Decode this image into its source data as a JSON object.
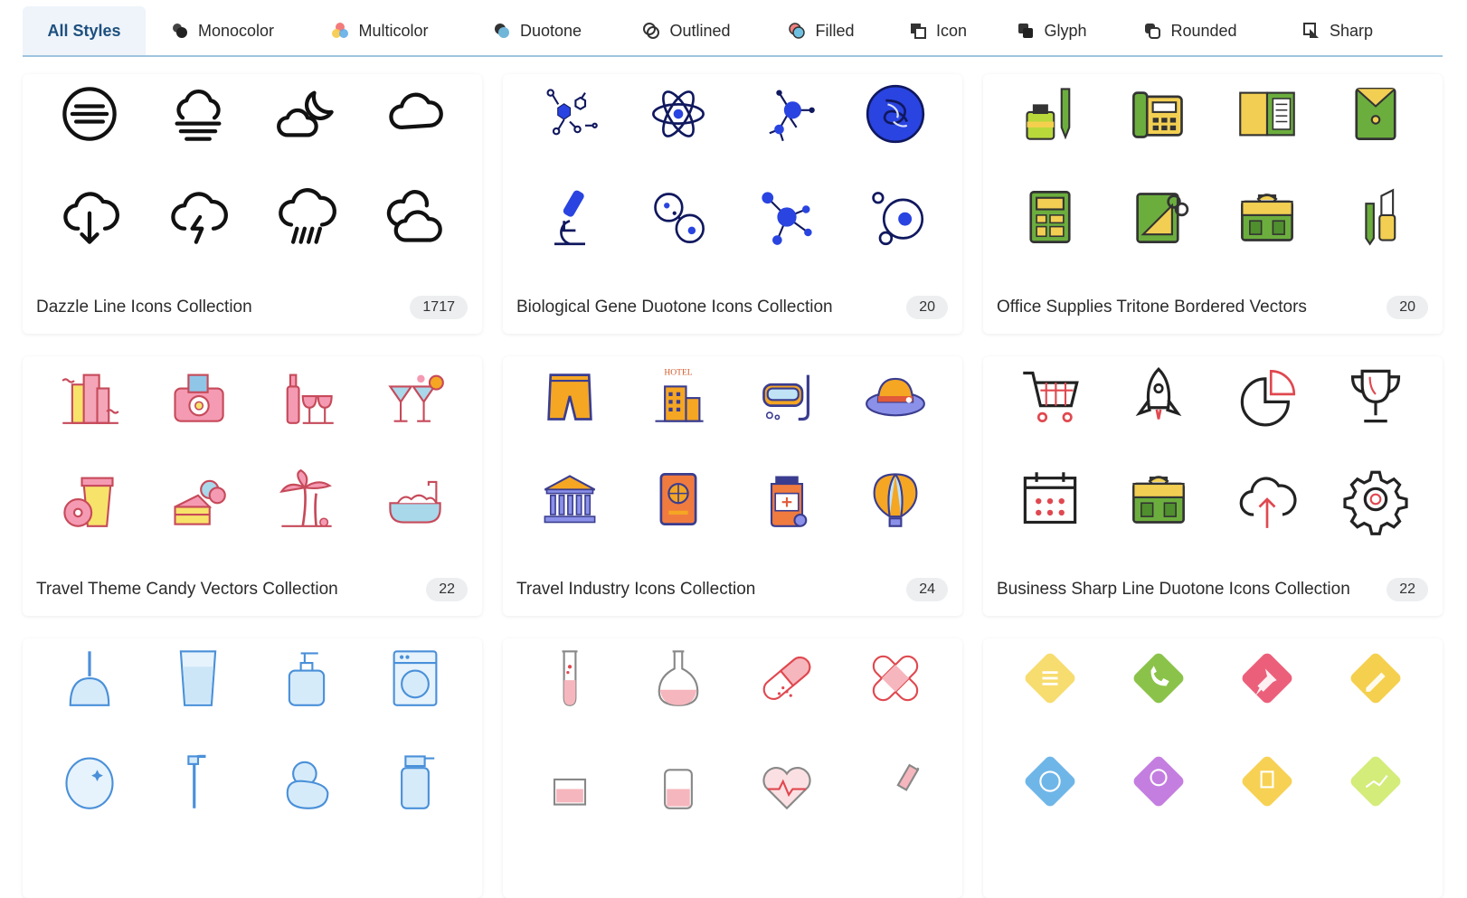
{
  "tabs": [
    {
      "label": "All Styles",
      "icon": "none",
      "active": true
    },
    {
      "label": "Monocolor",
      "icon": "monocolor-icon"
    },
    {
      "label": "Multicolor",
      "icon": "multicolor-icon"
    },
    {
      "label": "Duotone",
      "icon": "duotone-icon"
    },
    {
      "label": "Outlined",
      "icon": "outlined-icon"
    },
    {
      "label": "Filled",
      "icon": "filled-icon"
    },
    {
      "label": "Icon",
      "icon": "icon-style-icon"
    },
    {
      "label": "Glyph",
      "icon": "glyph-icon"
    },
    {
      "label": "Rounded",
      "icon": "rounded-icon"
    },
    {
      "label": "Sharp",
      "icon": "sharp-icon"
    }
  ],
  "collections": [
    {
      "title": "Dazzle Line Icons Collection",
      "count": "1717",
      "icons": [
        "fog-icon",
        "fog-cloud-icon",
        "moon-cloud-icon",
        "cloud-icon",
        "cloud-download-icon",
        "thunder-cloud-icon",
        "rain-cloud-icon",
        "double-cloud-icon"
      ]
    },
    {
      "title": "Biological Gene Duotone Icons Collection",
      "count": "20",
      "icons": [
        "molecule-structure-icon",
        "atom-icon",
        "molecule-nodes-icon",
        "dna-circle-icon",
        "microscope-icon",
        "cell-division-icon",
        "molecule-icon",
        "cells-icon"
      ]
    },
    {
      "title": "Office Supplies Tritone Bordered Vectors",
      "count": "20",
      "icons": [
        "ink-pen-icon",
        "telephone-icon",
        "folder-document-icon",
        "envelope-icon",
        "calculator-icon",
        "stationery-tools-icon",
        "briefcase-icon",
        "pencil-cutter-icon"
      ]
    },
    {
      "title": "Travel Theme Candy Vectors Collection",
      "count": "22",
      "icons": [
        "city-buildings-icon",
        "camera-icon",
        "wine-glasses-icon",
        "cocktails-icon",
        "coffee-donut-icon",
        "cake-ice-cream-icon",
        "palm-trees-icon",
        "bathtub-icon"
      ]
    },
    {
      "title": "Travel Industry Icons Collection",
      "count": "24",
      "icons": [
        "shorts-icon",
        "hotel-icon",
        "diving-mask-icon",
        "sun-hat-icon",
        "museum-icon",
        "passport-icon",
        "medicine-bottle-icon",
        "hot-air-balloon-icon"
      ]
    },
    {
      "title": "Business Sharp Line Duotone Icons Collection",
      "count": "22",
      "icons": [
        "shopping-cart-icon",
        "rocket-icon",
        "pie-chart-icon",
        "trophy-icon",
        "calendar-icon",
        "briefcase-icon",
        "cloud-upload-icon",
        "gear-icon"
      ]
    },
    {
      "title": "",
      "count": "",
      "icons": [
        "plunger-icon",
        "water-glass-icon",
        "soap-dispenser-icon",
        "washing-machine-icon",
        "mirror-icon",
        "shower-icon",
        "rubber-duck-icon",
        "spray-bottle-icon"
      ]
    },
    {
      "title": "",
      "count": "",
      "icons": [
        "test-tube-icon",
        "flask-icon",
        "pill-capsule-icon",
        "bandage-icon",
        "beaker-icon",
        "jar-icon",
        "heart-rate-icon",
        "syringe-icon"
      ]
    },
    {
      "title": "",
      "count": "",
      "icons": [
        "note-list-icon",
        "phone-call-icon",
        "pushpin-icon",
        "pencil-icon",
        "globe-icon",
        "location-pin-icon",
        "document-icon",
        "chart-icon"
      ]
    }
  ]
}
